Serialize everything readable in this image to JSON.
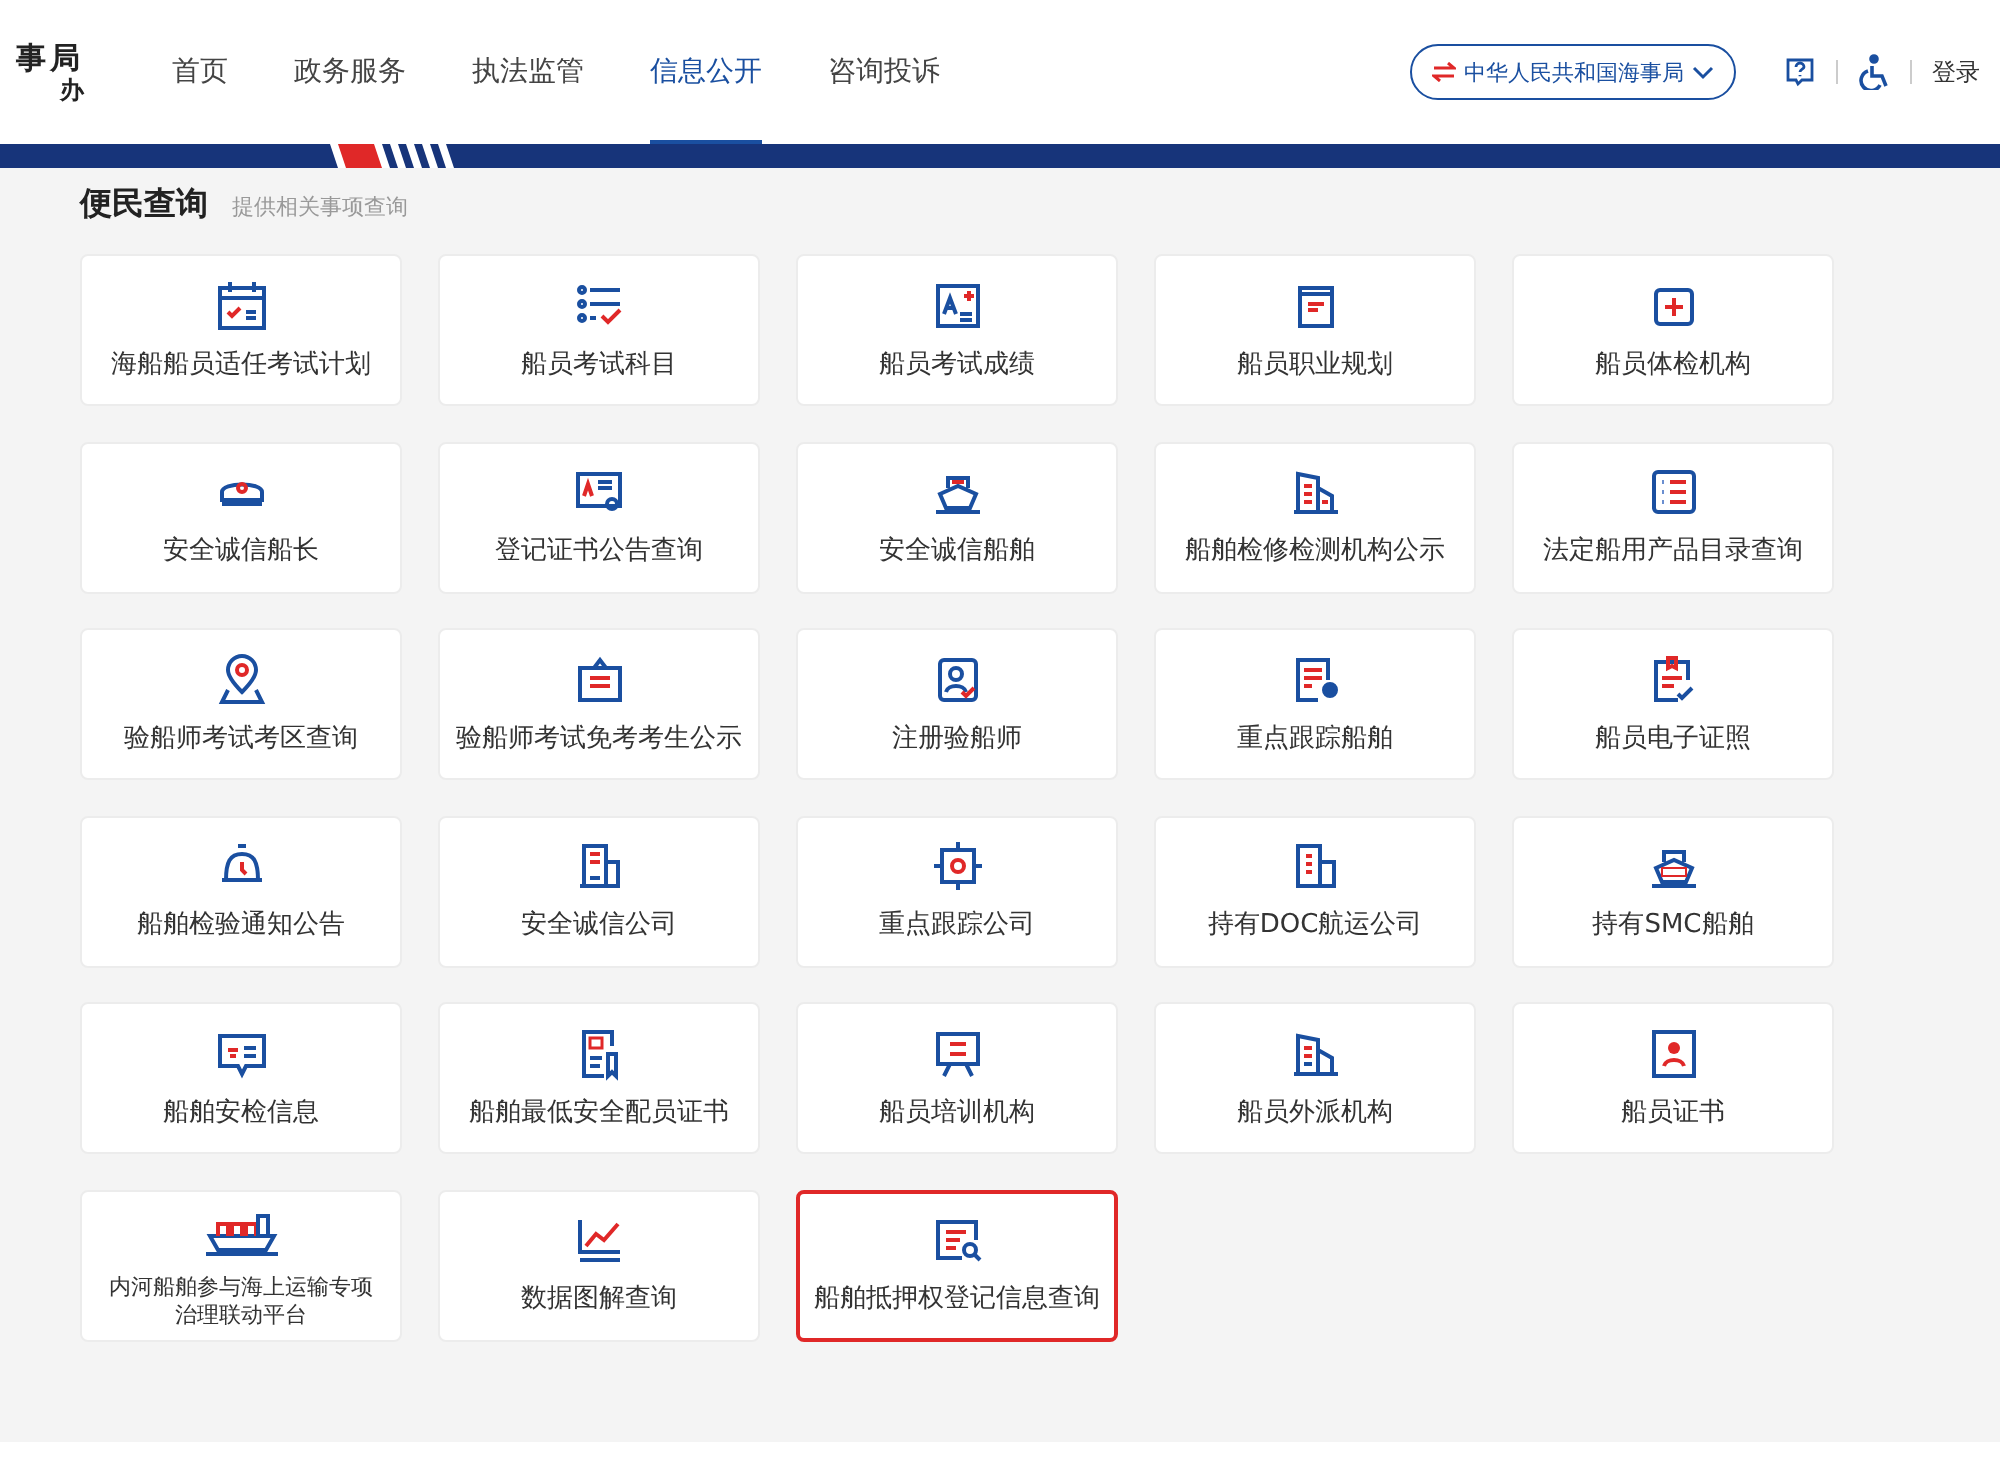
{
  "logo": {
    "line_1": "事局",
    "line_2": "办"
  },
  "nav": [
    {
      "label": "首页",
      "selected": false
    },
    {
      "label": "政务服务",
      "selected": false
    },
    {
      "label": "执法监管",
      "selected": false
    },
    {
      "label": "信息公开",
      "selected": true
    },
    {
      "label": "咨询投诉",
      "selected": false
    }
  ],
  "site_switch": "中华人民共和国海事局",
  "login": "登录",
  "section": {
    "title": "便民查询",
    "subtitle": "提供相关事项查询"
  },
  "tiles": [
    {
      "label": "海船船员适任考试计划",
      "kind": "normal",
      "highlighted": false
    },
    {
      "label": "船员考试科目",
      "kind": "normal",
      "highlighted": false
    },
    {
      "label": "船员考试成绩",
      "kind": "normal",
      "highlighted": false
    },
    {
      "label": "船员职业规划",
      "kind": "normal",
      "highlighted": false
    },
    {
      "label": "船员体检机构",
      "kind": "normal",
      "highlighted": false
    },
    {
      "label": "安全诚信船长",
      "kind": "normal",
      "highlighted": false
    },
    {
      "label": "登记证书公告查询",
      "kind": "normal",
      "highlighted": false
    },
    {
      "label": "安全诚信船舶",
      "kind": "normal",
      "highlighted": false
    },
    {
      "label": "船舶检修检测机构公示",
      "kind": "normal",
      "highlighted": false
    },
    {
      "label": "法定船用产品目录查询",
      "kind": "normal",
      "highlighted": false
    },
    {
      "label": "验船师考试考区查询",
      "kind": "normal",
      "highlighted": false
    },
    {
      "label": "验船师考试免考考生公示",
      "kind": "normal",
      "highlighted": false
    },
    {
      "label": "注册验船师",
      "kind": "normal",
      "highlighted": false
    },
    {
      "label": "重点跟踪船舶",
      "kind": "normal",
      "highlighted": false
    },
    {
      "label": "船员电子证照",
      "kind": "normal",
      "highlighted": false
    },
    {
      "label": "船舶检验通知公告",
      "kind": "normal",
      "highlighted": false
    },
    {
      "label": "安全诚信公司",
      "kind": "normal",
      "highlighted": false
    },
    {
      "label": "重点跟踪公司",
      "kind": "normal",
      "highlighted": false
    },
    {
      "label": "持有DOC航运公司",
      "kind": "normal",
      "highlighted": false
    },
    {
      "label": "持有SMC船舶",
      "kind": "normal",
      "highlighted": false
    },
    {
      "label": "船舶安检信息",
      "kind": "normal",
      "highlighted": false
    },
    {
      "label": "船舶最低安全配员证书",
      "kind": "normal",
      "highlighted": false
    },
    {
      "label": "船员培训机构",
      "kind": "normal",
      "highlighted": false
    },
    {
      "label": "船员外派机构",
      "kind": "normal",
      "highlighted": false
    },
    {
      "label": "船员证书",
      "kind": "normal",
      "highlighted": false
    },
    {
      "label": "内河船舶参与海上运输专项治理联动平台",
      "kind": "small",
      "highlighted": false
    },
    {
      "label": "数据图解查询",
      "kind": "normal",
      "highlighted": false
    },
    {
      "label": "船舶抵押权登记信息查询",
      "kind": "normal",
      "highlighted": true
    }
  ]
}
